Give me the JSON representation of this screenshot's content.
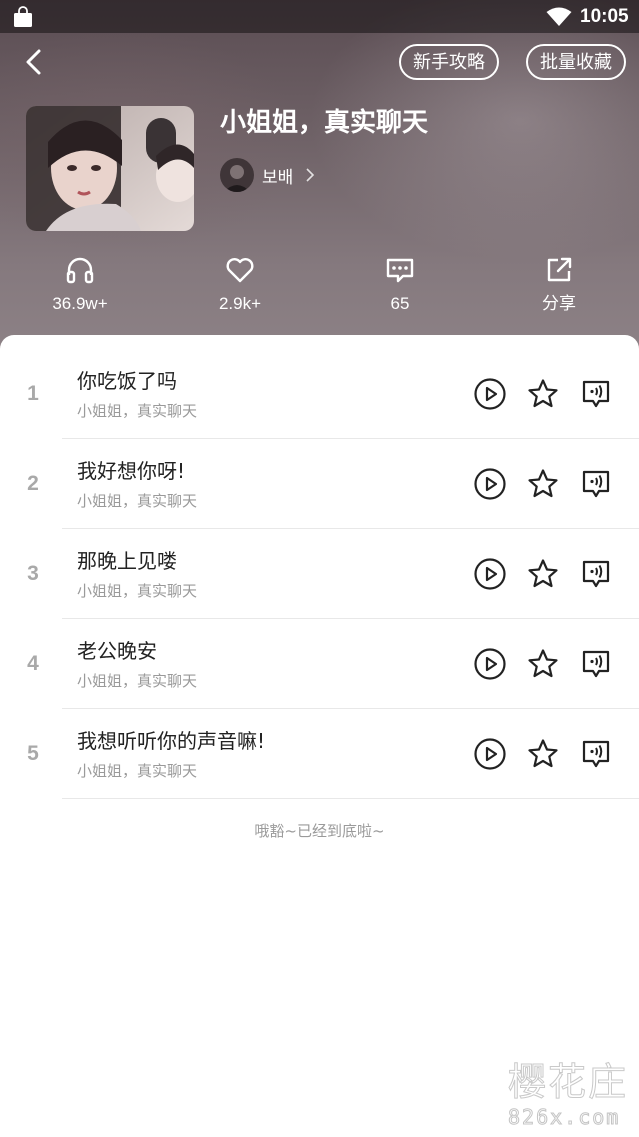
{
  "status_bar": {
    "time": "10:05"
  },
  "nav": {
    "guide_label": "新手攻略",
    "batch_collect_label": "批量收藏"
  },
  "album": {
    "title": "小姐姐，真实聊天",
    "author": "보배"
  },
  "stats": {
    "plays": "36.9w+",
    "likes": "2.9k+",
    "comments": "65",
    "share": "分享"
  },
  "tracks": [
    {
      "number": "1",
      "title": "你吃饭了吗",
      "subtitle": "小姐姐，真实聊天"
    },
    {
      "number": "2",
      "title": "我好想你呀!",
      "subtitle": "小姐姐，真实聊天"
    },
    {
      "number": "3",
      "title": "那晚上见喽",
      "subtitle": "小姐姐，真实聊天"
    },
    {
      "number": "4",
      "title": "老公晚安",
      "subtitle": "小姐姐，真实聊天"
    },
    {
      "number": "5",
      "title": "我想听听你的声音嘛!",
      "subtitle": "小姐姐，真实聊天"
    }
  ],
  "list_end_note": "哦豁~已经到底啦~",
  "watermark": {
    "title": "樱花庄",
    "url": "826x.com"
  },
  "icons": {
    "back": "chevron-left-icon",
    "plays": "headphones-icon",
    "likes": "heart-icon",
    "comments": "comment-icon",
    "share": "share-icon",
    "play": "play-circle-icon",
    "favorite": "star-icon",
    "voice": "voice-message-icon"
  },
  "colors": {
    "header_top": "#5b4d53",
    "header_bottom": "#8f8488",
    "title_text": "#222222",
    "secondary_text": "#9a9a9a",
    "track_number": "#a9a9a9",
    "divider": "#e8e8e8"
  }
}
